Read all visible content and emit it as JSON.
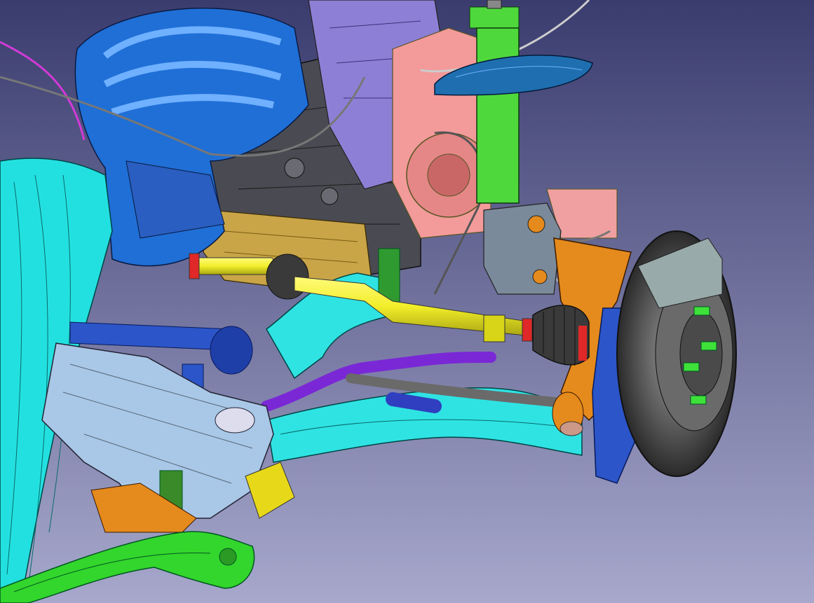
{
  "viewport": {
    "background_top": "#3a3c6e",
    "background_bottom": "#a7a8cc"
  },
  "parts": {
    "engine_block_color": "#4a4a52",
    "exhaust_manifold_color": "#1f6fd6",
    "heat_shield_color": "#23e0e0",
    "driveshaft_color": "#f2ee2a",
    "boot_color": "#3a3a3a",
    "subframe_color": "#a9c7e6",
    "control_arm_color": "#2fe3e3",
    "strut_color": "#4fd83c",
    "spring_seat_color": "#1f6fb0",
    "knuckle_color": "#e58a1c",
    "brake_disc_color": "#5a5a5a",
    "caliper_color": "#2c55c9",
    "stabilizer_bar_color": "#7a28d6",
    "bracket_color": "#f39a9a",
    "lower_crossmember_color": "#33d62c",
    "transmission_color": "#c9a548",
    "wheel_stud_color": "#3ee03a",
    "tie_rod_color": "#6a6a6a"
  }
}
